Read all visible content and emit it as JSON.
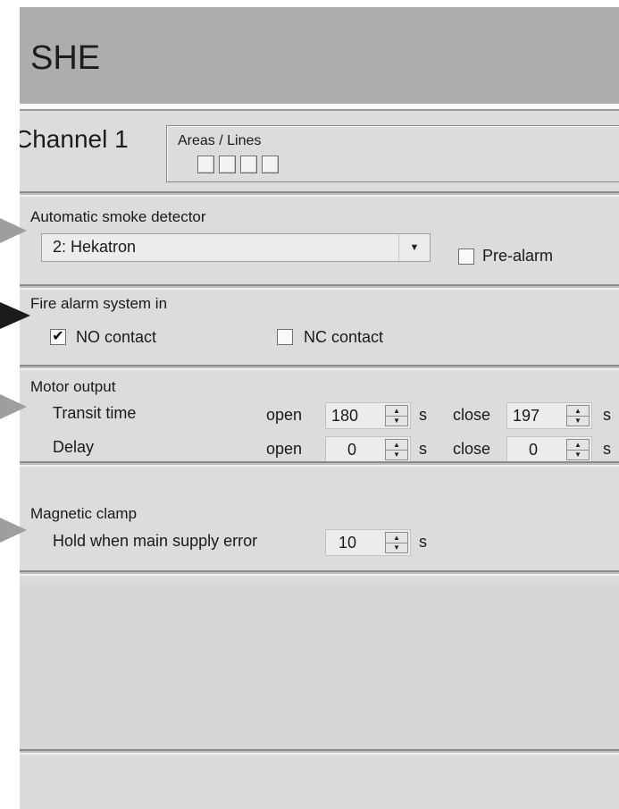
{
  "window": {
    "title": "SHE"
  },
  "channel": {
    "label": "Channel 1",
    "areas_label": "Areas / Lines",
    "areas": [
      {
        "name": "area-1",
        "checked": false
      },
      {
        "name": "area-2",
        "checked": false
      },
      {
        "name": "area-3",
        "checked": false
      },
      {
        "name": "area-4",
        "checked": false
      }
    ]
  },
  "smoke_detector": {
    "section_label": "Automatic smoke detector",
    "selected": "2: Hekatron",
    "prealarm_label": "Pre-alarm",
    "prealarm_checked": false
  },
  "fire_alarm": {
    "section_label": "Fire alarm system in",
    "no_label": "NO contact",
    "no_checked": true,
    "nc_label": "NC contact",
    "nc_checked": false,
    "check_glyph": "✔"
  },
  "motor_output": {
    "section_label": "Motor output",
    "transit": {
      "label": "Transit time",
      "open_label": "open",
      "open_value": "180",
      "open_unit": "s",
      "close_label": "close",
      "close_value": "197",
      "close_unit": "s"
    },
    "delay": {
      "label": "Delay",
      "open_label": "open",
      "open_value": "0",
      "open_unit": "s",
      "close_label": "close",
      "close_value": "0",
      "close_unit": "s"
    }
  },
  "magnetic_clamp": {
    "section_label": "Magnetic clamp",
    "hold_label": "Hold when main supply error",
    "hold_value": "10",
    "hold_unit": "s"
  },
  "glyphs": {
    "dropdown_arrow": "▼",
    "spin_up": "▲",
    "spin_down": "▼"
  },
  "colors": {
    "title_bar": "#adadad",
    "panel": "#dcdcdc",
    "marker_gray": "#9e9e9e",
    "marker_black": "#1a1a1a"
  }
}
